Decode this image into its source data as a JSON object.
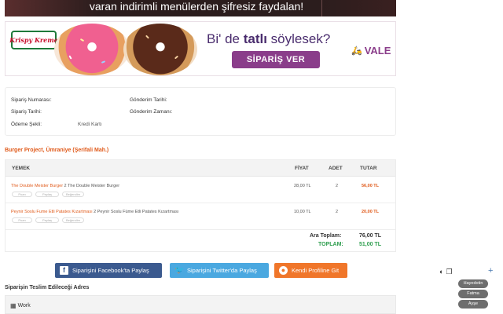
{
  "top_banner": {
    "text": "varan indirimli menülerden şifresiz faydalan!"
  },
  "ad": {
    "logo_text": "Krispy Kreme",
    "headline_prefix": "Bi' de ",
    "headline_bold": "tatlı",
    "headline_suffix": " söylesek?",
    "button_label": "SİPARİŞ VER",
    "partner_logo": "VALE",
    "colors": {
      "purple": "#8a3d8a",
      "brand_green": "#1e7a3a"
    }
  },
  "order_info": {
    "order_number_label": "Sipariş Numarası:",
    "order_date_label": "Sipariş Tarihi:",
    "payment_label": "Ödeme Şekli:",
    "payment_value": "Kredi Kartı",
    "send_date_label": "Gönderim Tarihi:",
    "send_time_label": "Gönderim Zamanı:"
  },
  "restaurant": {
    "name": "Burger Project, Ümraniye (Şerifali Mah.)"
  },
  "table": {
    "headers": {
      "item": "YEMEK",
      "price": "FİYAT",
      "qty": "ADET",
      "total": "TUTAR"
    },
    "rows": [
      {
        "name_highlight": "The Double Meister Burger",
        "name_rest": " 2 The Double Meister Burger",
        "price": "28,00 TL",
        "qty": "2",
        "total": "56,00 TL",
        "pills": [
          "Puan",
          "Paylaş",
          "Beğendim"
        ]
      },
      {
        "name_highlight": "Peynir Soslu Fume Etli Patates Kızartması",
        "name_rest": " 2 Peynir Soslu Füme Etli Patates Kızartması",
        "price": "10,00 TL",
        "qty": "2",
        "total": "20,00 TL",
        "pills": [
          "Puan",
          "Paylaş",
          "Beğendim"
        ]
      }
    ],
    "subtotal_label": "Ara Toplam:",
    "subtotal_value": "76,00 TL",
    "total_label": "TOPLAM:",
    "total_value": "51,00 TL"
  },
  "share": {
    "facebook": "Siparişini Facebook'ta Paylaş",
    "twitter": "Siparişini Twitter'da Paylaş",
    "profile": "Kendi Profiline Git"
  },
  "address": {
    "title": "Siparişin Teslim Edileceği Adres",
    "work_label": "Work"
  },
  "side_widget": {
    "buttons": [
      "Hayedotin",
      "Fatma",
      "Ayşe"
    ],
    "plus": "+"
  }
}
